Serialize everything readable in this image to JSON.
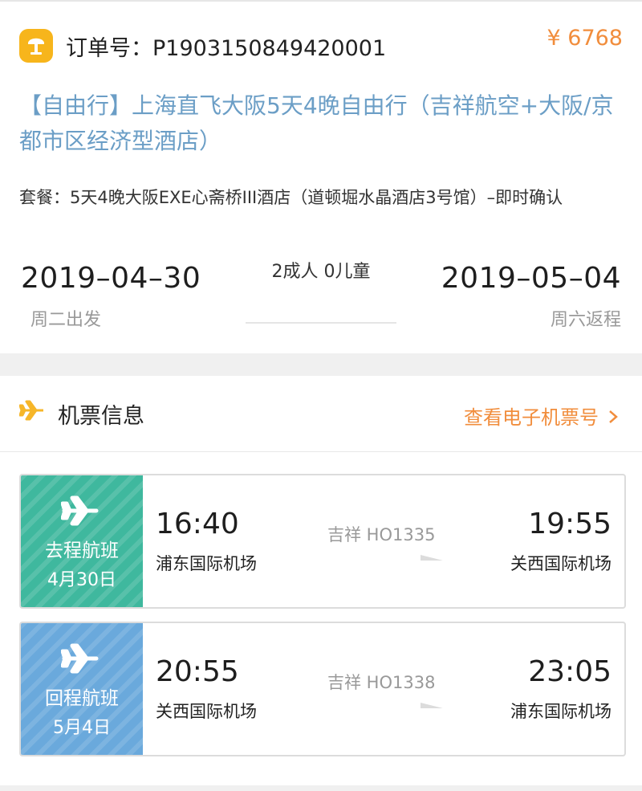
{
  "order": {
    "order_label": "订单号：P1903150849420001",
    "price": "¥ 6768",
    "title": "【自由行】上海直飞大阪5天4晚自由行（吉祥航空+大阪/京都市区经济型酒店）",
    "package": "套餐：5天4晚大阪EXE心斋桥III酒店（道顿堀水晶酒店3号馆）–即时确认",
    "depart_date": "2019–04–30",
    "depart_label": "周二出发",
    "pax": "2成人 0儿童",
    "return_date": "2019–05–04",
    "return_label": "周六返程"
  },
  "flights": {
    "section_title": "机票信息",
    "eticket_link": "查看电子机票号",
    "items": [
      {
        "type": "去程航班",
        "date": "4月30日",
        "dep_time": "16:40",
        "dep_airport": "浦东国际机场",
        "flight_no": "吉祥 HO1335",
        "arr_time": "19:55",
        "arr_airport": "关西国际机场"
      },
      {
        "type": "回程航班",
        "date": "5月4日",
        "dep_time": "20:55",
        "dep_airport": "关西国际机场",
        "flight_no": "吉祥 HO1338",
        "arr_time": "23:05",
        "arr_airport": "浦东国际机场"
      }
    ]
  },
  "colors": {
    "accent_orange": "#f18d3c",
    "title_blue": "#6b9ec6",
    "outbound_green": "#3fb89e",
    "return_blue": "#6aa9dc",
    "logo_yellow": "#f7b51c"
  },
  "icons": [
    "logo-icon",
    "airplane-icon",
    "chevron-right-icon",
    "arrow-right-icon"
  ]
}
